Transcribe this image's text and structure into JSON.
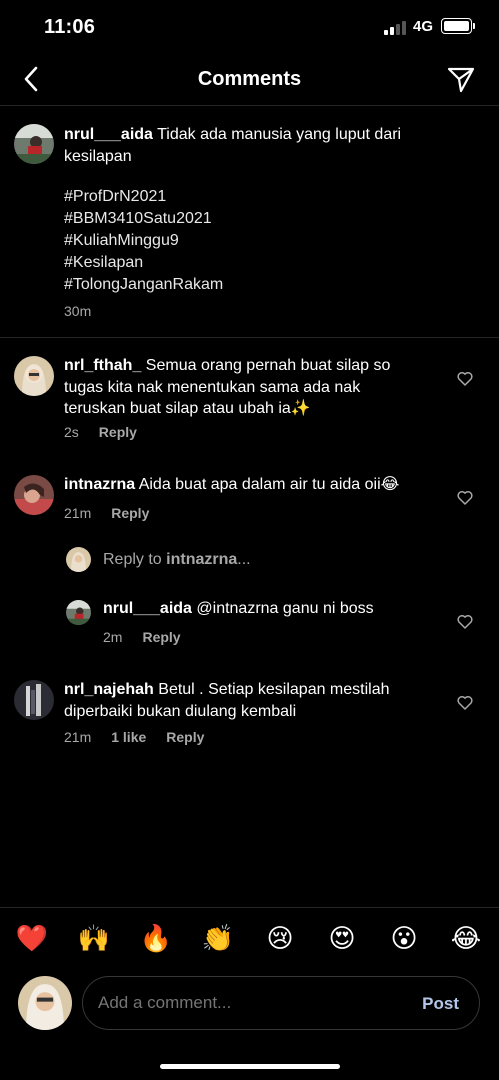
{
  "status_bar": {
    "time": "11:06",
    "network": "4G"
  },
  "header": {
    "title": "Comments"
  },
  "caption": {
    "username": "nrul___aida",
    "text": "Tidak ada manusia yang luput dari",
    "text_line2": "kesilapan",
    "hashtags": [
      "#ProfDrN2021",
      "#BBM3410Satu2021",
      "#KuliahMinggu9",
      "#Kesilapan",
      "#TolongJanganRakam"
    ],
    "time": "30m"
  },
  "comments": [
    {
      "username": "nrl_fthah_",
      "line1": "Semua orang pernah buat silap so",
      "line2": "tugas kita nak menentukan sama ada nak",
      "line3": "teruskan buat silap atau ubah ia✨",
      "time": "2s",
      "reply_label": "Reply"
    },
    {
      "username": "intnazrna",
      "text": "Aida buat apa dalam air tu aida oii😂",
      "time": "21m",
      "reply_label": "Reply",
      "reply_prompt_prefix": "Reply to ",
      "reply_prompt_user": "intnazrna",
      "reply_prompt_suffix": "...",
      "reply": {
        "username": "nrul___aida",
        "text": "@intnazrna ganu ni boss",
        "time": "2m",
        "reply_label": "Reply"
      }
    },
    {
      "username": "nrl_najehah",
      "line1": "Betul . Setiap kesilapan mestilah",
      "line2": "diperbaiki bukan diulang kembali",
      "time": "21m",
      "likes": "1 like",
      "reply_label": "Reply"
    }
  ],
  "emoji_bar": [
    "❤️",
    "🙌",
    "🔥",
    "👏",
    "😢",
    "😍",
    "😮",
    "😂"
  ],
  "composer": {
    "placeholder": "Add a comment...",
    "post_label": "Post"
  },
  "colors": {
    "background": "#000000",
    "divider": "#262626",
    "muted": "#a8a8a8",
    "post": "#b3c6ea"
  }
}
